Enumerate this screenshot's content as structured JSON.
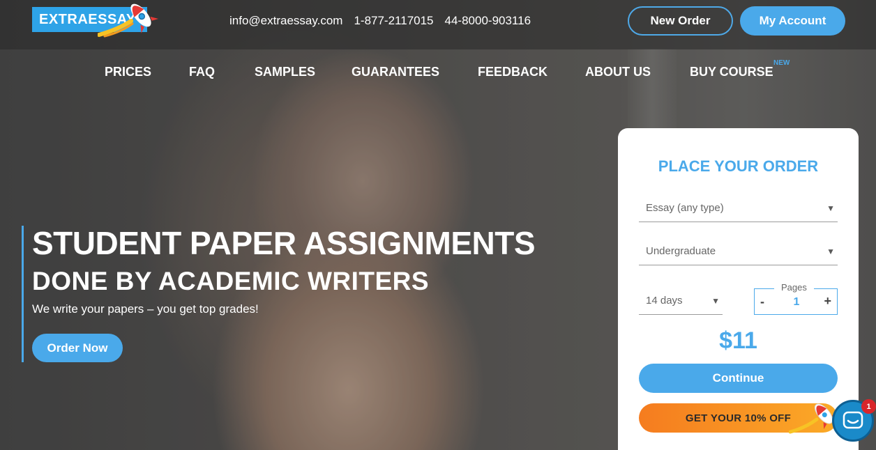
{
  "brand": {
    "logo_text": "EXTRAESSAY",
    "accent": "#4aa9ea",
    "orange": "#f7931e"
  },
  "header": {
    "email": "info@extraessay.com",
    "phone_us": "1-877-2117015",
    "phone_uk": "44-8000-903116",
    "new_order_label": "New Order",
    "my_account_label": "My Account"
  },
  "nav": {
    "items": [
      {
        "label": "PRICES"
      },
      {
        "label": "FAQ"
      },
      {
        "label": "SAMPLES"
      },
      {
        "label": "GUARANTEES"
      },
      {
        "label": "FEEDBACK"
      },
      {
        "label": "ABOUT US"
      },
      {
        "label": "BUY COURSE"
      }
    ],
    "new_badge": "NEW"
  },
  "hero": {
    "title": "STUDENT PAPER ASSIGNMENTS",
    "subtitle": "DONE BY ACADEMIC WRITERS",
    "tagline": "We write your papers – you get top grades!",
    "cta_label": "Order Now"
  },
  "order_form": {
    "title": "PLACE YOUR ORDER",
    "paper_type": "Essay (any type)",
    "academic_level": "Undergraduate",
    "deadline": "14 days",
    "pages_label": "Pages",
    "pages_minus": "-",
    "pages_value": "1",
    "pages_plus": "+",
    "price": "$11",
    "continue_label": "Continue",
    "discount_label": "GET YOUR 10% OFF"
  },
  "chat": {
    "unread_count": "1"
  }
}
